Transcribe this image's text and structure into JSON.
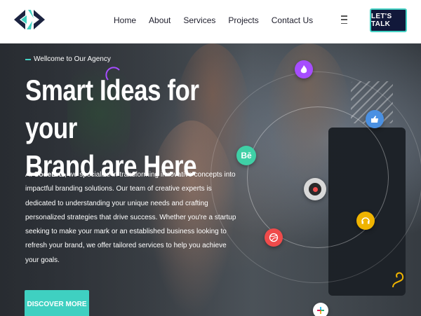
{
  "header": {
    "nav": [
      "Home",
      "About",
      "Services",
      "Projects",
      "Contact Us"
    ],
    "cta_label": "LET'S TALK"
  },
  "hero": {
    "eyebrow": "Wellcome to Our Agency",
    "headline_line1": "Smart Ideas for your",
    "headline_line2": "Brand are Here",
    "paragraph_prefix": "At ",
    "company": "CodeErtz",
    "paragraph_rest": ", we specialize in transforming innovative concepts into impactful branding solutions. Our team of creative experts is dedicated to understanding your unique needs and crafting personalized strategies that drive success. Whether you're a startup seeking to make your mark or an established business looking to refresh your brand, we offer tailored services to help you achieve your goals.",
    "button_label": "DISCOVER MORE"
  },
  "badges": {
    "behance_text": "Bē"
  },
  "colors": {
    "accent": "#3fd0c1",
    "navy": "#11183a",
    "purple_badge": "#a64dff",
    "behance_badge": "#3fd0a6",
    "blue_badge": "#4a90e2",
    "yellow_badge": "#f0b400",
    "red_badge": "#ef4b4b"
  }
}
